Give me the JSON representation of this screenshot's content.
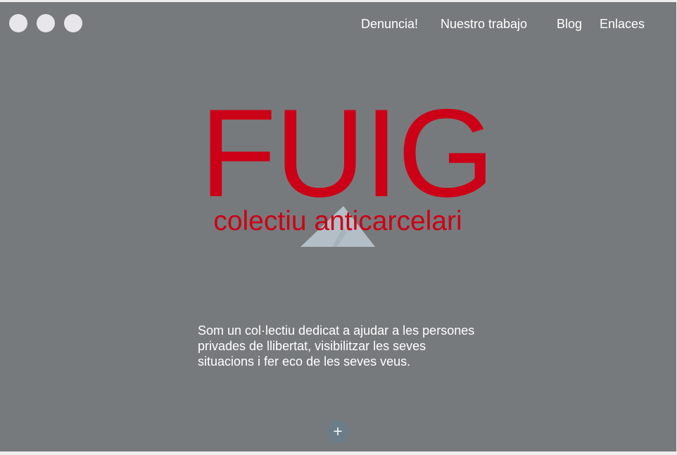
{
  "window_controls": [
    {
      "name": "control-1"
    },
    {
      "name": "control-2"
    },
    {
      "name": "control-3"
    }
  ],
  "nav": {
    "items": [
      {
        "label": "Denuncia!"
      },
      {
        "label": "Nuestro trabajo"
      },
      {
        "label": "Blog"
      },
      {
        "label": "Enlaces"
      }
    ]
  },
  "hero": {
    "title": "FUIG",
    "subtitle": "colectiu anticarcelari",
    "intro": "Som un col·lectiu dedicat a ajudar a les persones privades de llibertat, visibilitzar les seves situacions i fer eco de les seves veus.",
    "more_button": "+"
  },
  "colors": {
    "background": "#777a7c",
    "brand_red": "#cc0016",
    "mountain": "#b3bec6",
    "button": "#6a7d88"
  }
}
